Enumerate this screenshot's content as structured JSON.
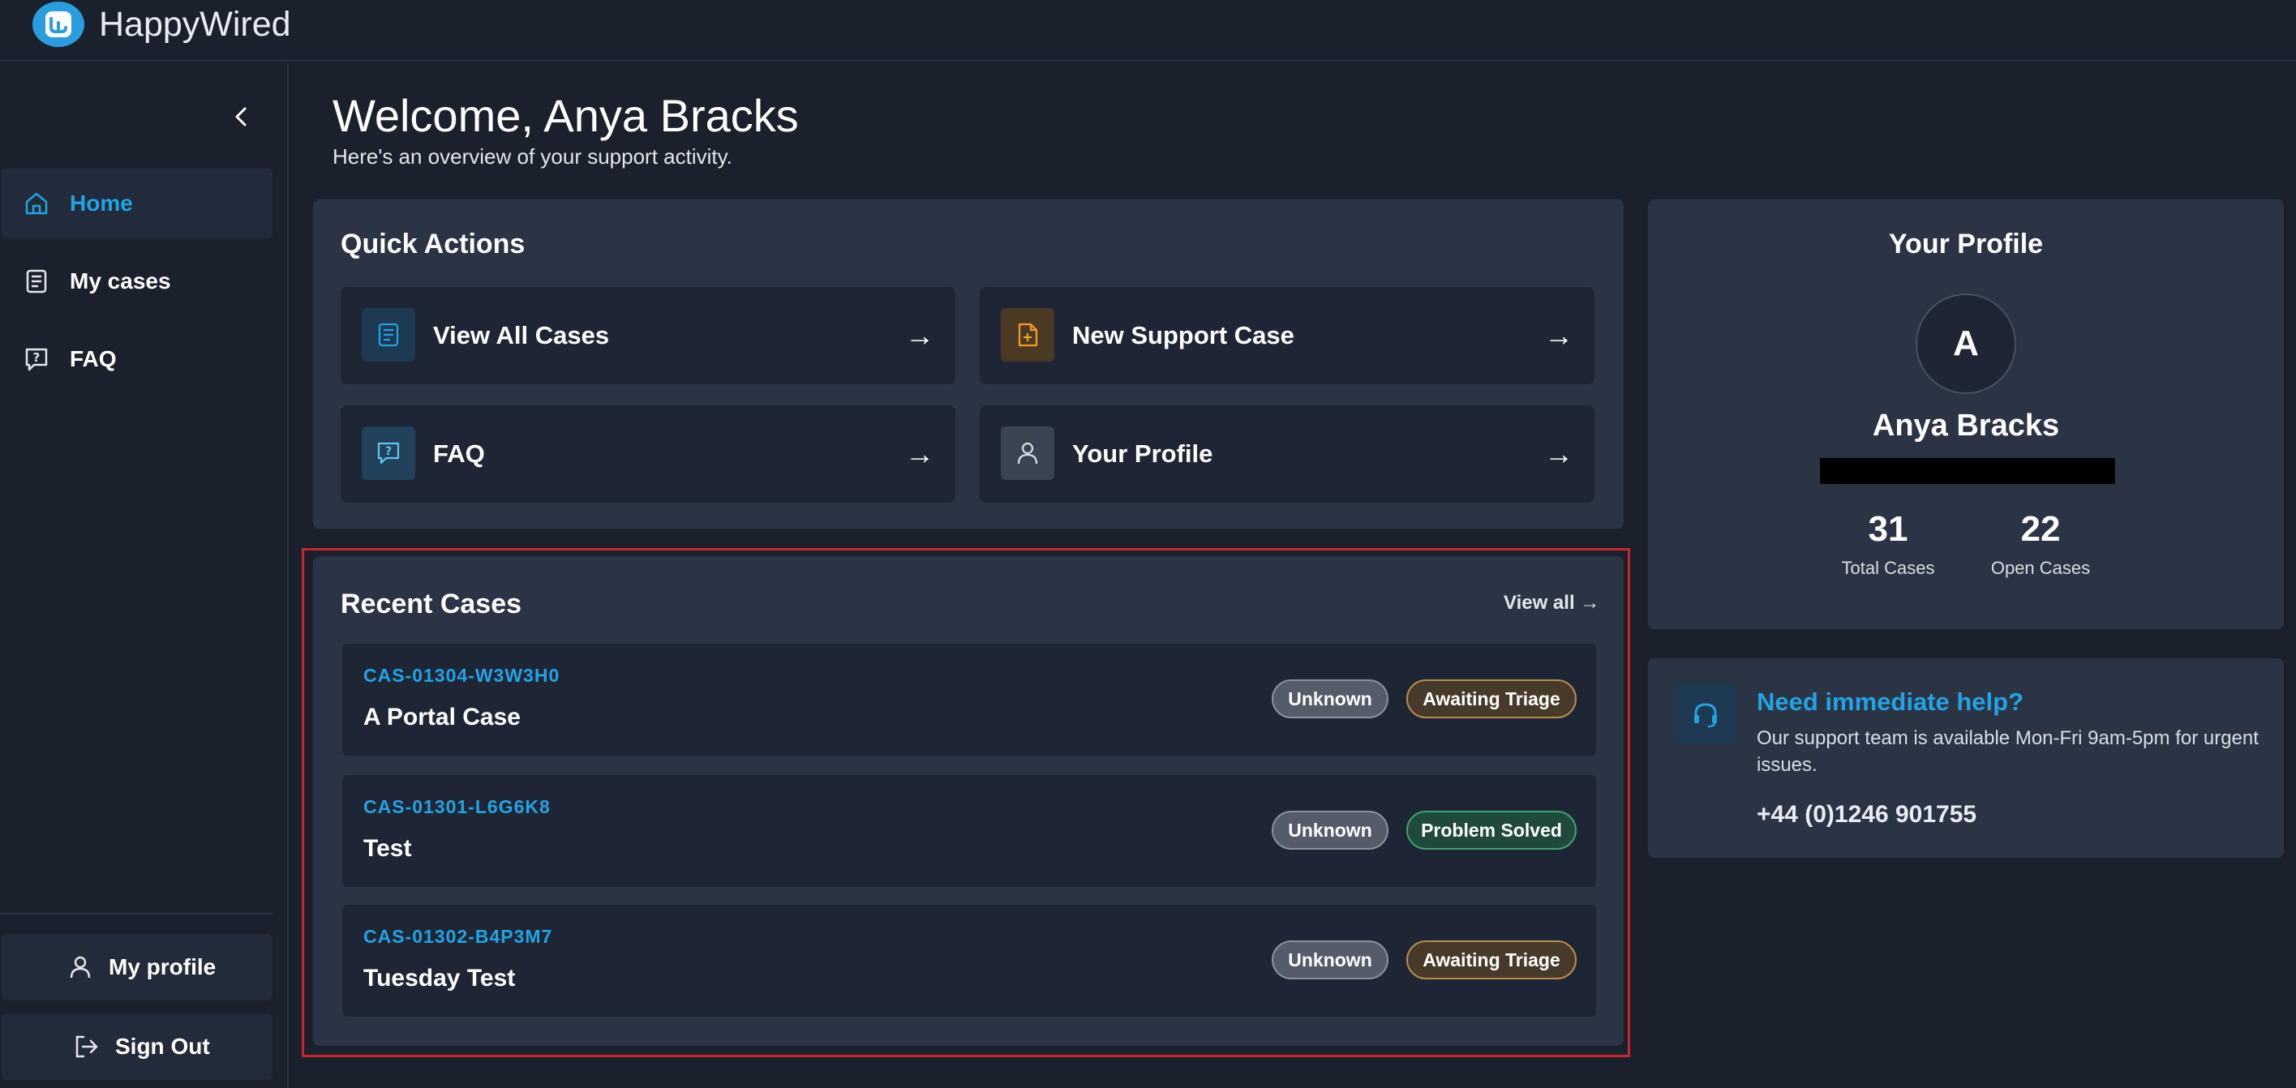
{
  "app": {
    "name": "HappyWired"
  },
  "sidebar": {
    "items": [
      {
        "label": "Home",
        "icon": "home-icon",
        "active": true
      },
      {
        "label": "My cases",
        "icon": "cases-icon",
        "active": false
      },
      {
        "label": "FAQ",
        "icon": "faq-icon",
        "active": false
      }
    ],
    "profile_label": "My profile",
    "signout_label": "Sign Out"
  },
  "header": {
    "welcome": "Welcome, Anya Bracks",
    "subtitle": "Here's an overview of your support activity."
  },
  "quick_actions": {
    "title": "Quick Actions",
    "items": [
      {
        "label": "View All Cases",
        "icon": "document-icon",
        "arrow": "→"
      },
      {
        "label": "New Support Case",
        "icon": "new-document-icon",
        "arrow": "→"
      },
      {
        "label": "FAQ",
        "icon": "faq-icon",
        "arrow": "→"
      },
      {
        "label": "Your Profile",
        "icon": "user-icon",
        "arrow": "→"
      }
    ]
  },
  "recent_cases": {
    "title": "Recent Cases",
    "view_all": "View all →",
    "rows": [
      {
        "id": "CAS-01304-W3W3H0",
        "title": "A Portal Case",
        "priority": "Unknown",
        "status": "Awaiting Triage"
      },
      {
        "id": "CAS-01301-L6G6K8",
        "title": "Test",
        "priority": "Unknown",
        "status": "Problem Solved"
      },
      {
        "id": "CAS-01302-B4P3M7",
        "title": "Tuesday Test",
        "priority": "Unknown",
        "status": "Awaiting Triage"
      }
    ]
  },
  "profile": {
    "title": "Your Profile",
    "initial": "A",
    "name": "Anya Bracks",
    "total_cases": "31",
    "total_cases_label": "Total Cases",
    "open_cases": "22",
    "open_cases_label": "Open Cases"
  },
  "help": {
    "title": "Need immediate help?",
    "text": "Our support team is available Mon-Fri 9am-5pm for urgent issues.",
    "phone": "+44 (0)1246 901755"
  },
  "colors": {
    "accent": "#22a3e3",
    "background": "#1b212c",
    "panel": "#2b3444",
    "highlight": "#c8262c"
  }
}
